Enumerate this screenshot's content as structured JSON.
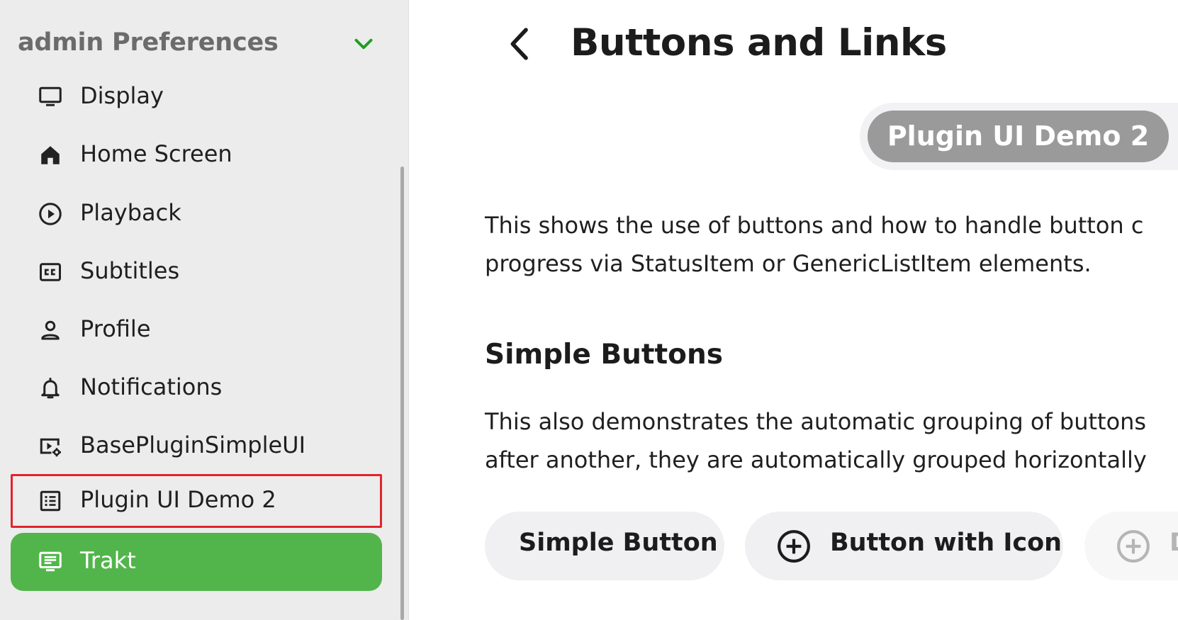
{
  "sidebar": {
    "title": "admin Preferences",
    "items": [
      {
        "label": "Display"
      },
      {
        "label": "Home Screen"
      },
      {
        "label": "Playback"
      },
      {
        "label": "Subtitles"
      },
      {
        "label": "Profile"
      },
      {
        "label": "Notifications"
      },
      {
        "label": "BasePluginSimpleUI"
      },
      {
        "label": "Plugin UI Demo 2"
      },
      {
        "label": "Trakt"
      }
    ]
  },
  "main": {
    "title": "Buttons and Links",
    "plugin_chip": "Plugin UI Demo 2",
    "intro_line1": "This shows the use of buttons and how to handle button c",
    "intro_line2": "progress via StatusItem or GenericListItem elements.",
    "section_title": "Simple Buttons",
    "section_line1": "This also demonstrates the automatic grouping of buttons",
    "section_line2": "after another, they are automatically grouped horizontally",
    "buttons": [
      {
        "label": "Simple Button"
      },
      {
        "label": "Button with Icon"
      },
      {
        "label": "D"
      }
    ]
  },
  "colors": {
    "active_green": "#52b54b",
    "focus_red": "#e2242c",
    "chevron_green": "#1f9d1f",
    "chip_gray": "#9a9a9a"
  },
  "icons": {
    "chevron": "chevron-down-icon",
    "display": "monitor-icon",
    "home": "home-icon",
    "playback": "play-circle-icon",
    "subtitles": "closed-caption-icon",
    "profile": "person-icon",
    "notifications": "bell-icon",
    "base_plugin": "video-settings-icon",
    "plugin_demo": "list-alt-icon",
    "trakt": "tv-list-icon",
    "back": "chevron-left-icon",
    "add": "add-circle-icon"
  }
}
